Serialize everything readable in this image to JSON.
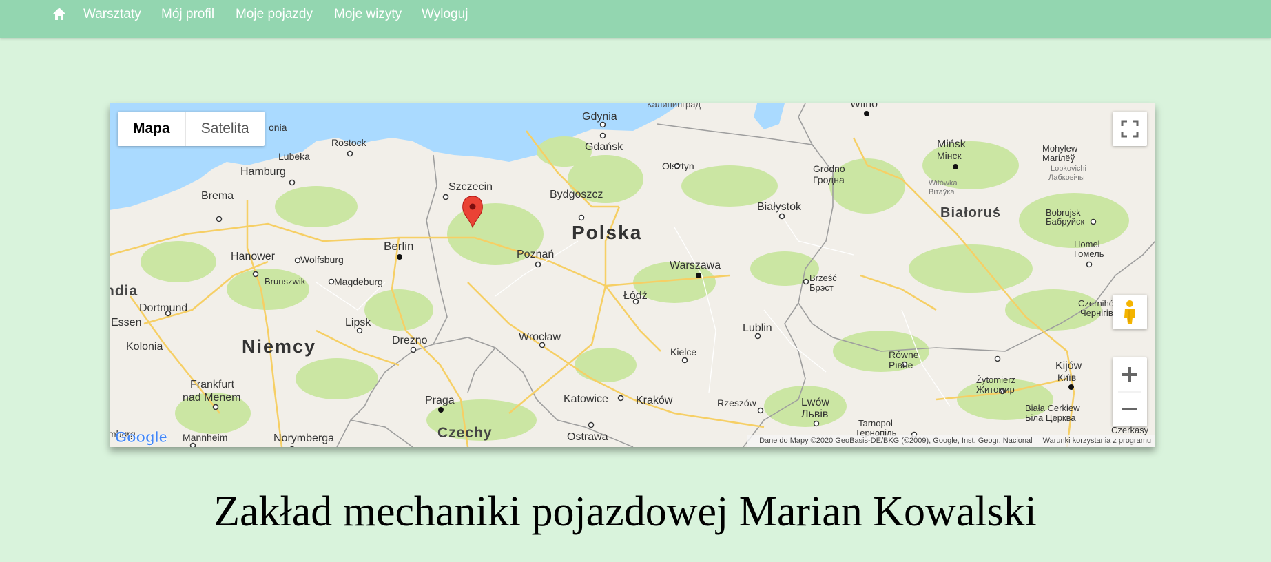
{
  "nav": {
    "home_icon": "home-icon",
    "links": [
      "Warsztaty",
      "Mój profil",
      "Moje pojazdy",
      "Moje wizyty",
      "Wyloguj"
    ]
  },
  "map": {
    "type_buttons": {
      "map": "Mapa",
      "satellite": "Satelita"
    },
    "labels": {
      "kaliningrad": "Калининград",
      "wilno": "Wilno",
      "gdynia": "Gdynia",
      "gdansk": "Gdańsk",
      "olsztyn": "Olsztyn",
      "minsk": "Mińsk",
      "minsk_ru": "Мінск",
      "mohylew": "Mohylew",
      "mohylew_ru": "Магілёў",
      "lobkovichi": "Lobkovichi",
      "lobkovichi_ru": "Лабковічы",
      "rostock": "Rostock",
      "lubeka": "Lubeka",
      "hamburg": "Hamburg",
      "bremen": "Brema",
      "szczecin": "Szczecin",
      "bydgoszcz": "Bydgoszcz",
      "grodno": "Grodno",
      "grodno_ru": "Гродна",
      "witowka": "Witówka",
      "witowka_ru": "Вітаўка",
      "bialystok": "Białystok",
      "bialorus": "Białoruś",
      "bobrujsk": "Bobrujsk",
      "bobrujsk_ru": "Бабруйск",
      "polska": "Polska",
      "berlin": "Berlin",
      "poznan": "Poznań",
      "hanover": "Hanower",
      "wolfsburg": "Wolfsburg",
      "brunszwik": "Brunszwik",
      "magdeburg": "Magdeburg",
      "warszawa": "Warszawa",
      "homel": "Homel",
      "homel_ru": "Гомель",
      "brzesc": "Brześć",
      "brzesc_ru": "Брэст",
      "lodz": "Łódź",
      "dortmund": "Dortmund",
      "essen": "Essen",
      "lipsk": "Lipsk",
      "lublin": "Lublin",
      "czernihow": "Czernihów",
      "czernihow_ru": "Чернігів",
      "kolonia": "Kolonia",
      "niemcy": "Niemcy",
      "drezno": "Drezno",
      "wroclaw": "Wrocław",
      "kielce": "Kielce",
      "rowne": "Równe",
      "rowne_ru": "Рівне",
      "kijow": "Kijów",
      "kijow_ru": "Київ",
      "frankfurt": "Frankfurt",
      "frankfurt2": "nad Menem",
      "praga": "Praga",
      "katowice": "Katowice",
      "krakow": "Kraków",
      "rzeszow": "Rzeszów",
      "lwow": "Lwów",
      "lwow_ru": "Львів",
      "zytomierz": "Żytomierz",
      "zytomierz_ru": "Житомир",
      "biala": "Biała Cerkiew",
      "biala_ru": "Біла Церква",
      "mannheim": "Mannheim",
      "norymberga": "Norymberga",
      "czechy": "Czechy",
      "ostrawa": "Ostrawa",
      "tarnopol": "Tarnopol",
      "tarnopol_ru": "Тернопіль",
      "czerkasy": "Czerkasy",
      "dia": "ndia",
      "onia": "onia",
      "mburg": "mburg"
    },
    "attribution": {
      "data": "Dane do Mapy ©2020 GeoBasis-DE/BKG (©2009), Google, Inst. Geogr. Nacional",
      "terms": "Warunki korzystania z programu"
    },
    "logo": "Google",
    "colors": {
      "water": "#aadaff",
      "land": "#f2efe9",
      "forest": "#cbe6a3",
      "highway": "#f6cf65",
      "marker": "#ea4335"
    }
  },
  "title": "Zakład mechaniki pojazdowej Marian Kowalski"
}
